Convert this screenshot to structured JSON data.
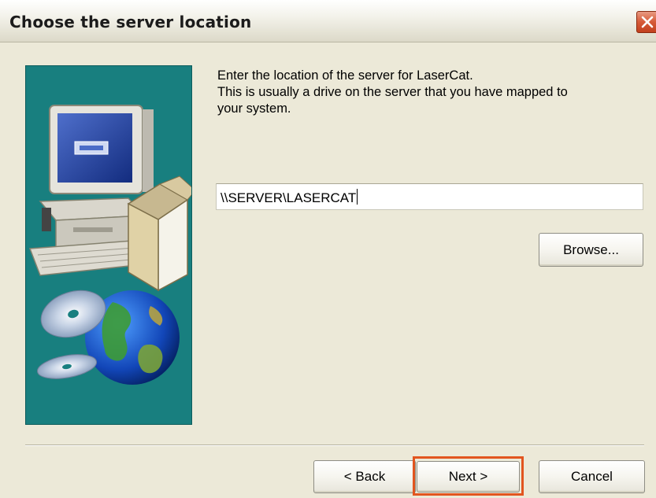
{
  "window": {
    "title": "Choose the server location",
    "close_icon": "close-icon",
    "accent_color": "#187f7f",
    "close_color": "#d65a38"
  },
  "instructions": {
    "line1": "Enter the location of the server for LaserCat.",
    "line2": "This is usually a drive on the server that you have mapped to",
    "line3": "your system."
  },
  "server_path": {
    "value": "\\\\SERVER\\LASERCAT"
  },
  "buttons": {
    "browse": "Browse...",
    "back": "< Back",
    "next": "Next >",
    "cancel": "Cancel"
  },
  "highlight_color": "#e2551f",
  "art": {
    "icon": "computer-globe-cd-illustration"
  }
}
